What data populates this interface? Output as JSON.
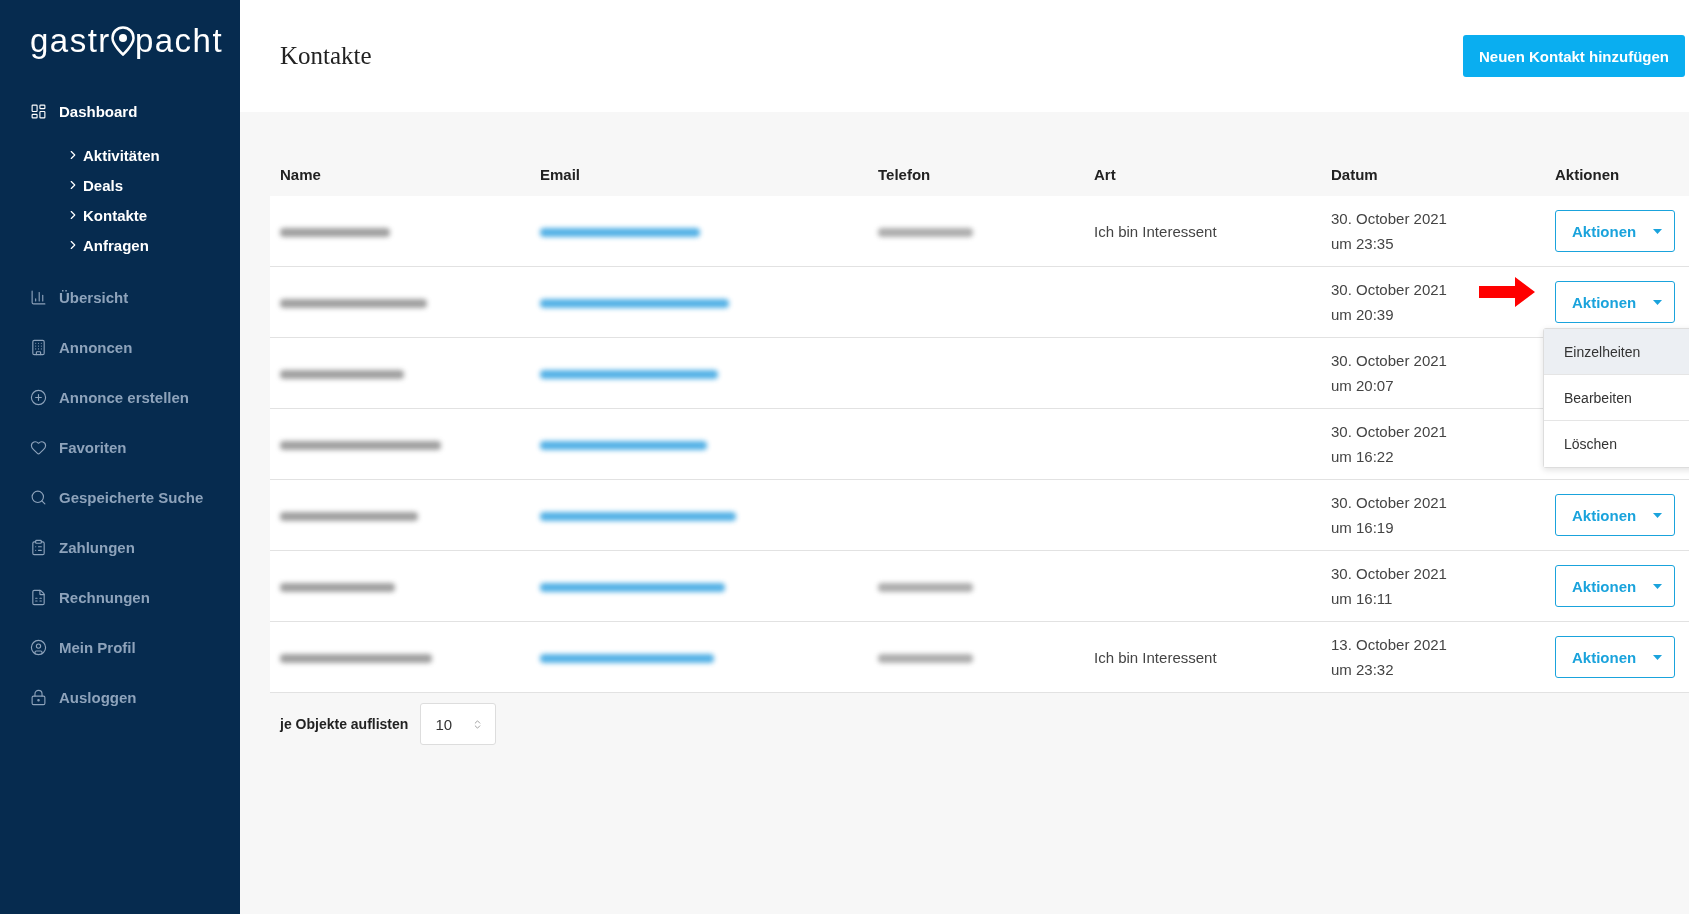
{
  "logo": {
    "left": "gastr",
    "right": "pacht"
  },
  "sidebar": {
    "items": [
      {
        "label": "Dashboard",
        "active": true,
        "expanded": true,
        "children": [
          {
            "label": "Aktivitäten",
            "active": true
          },
          {
            "label": "Deals",
            "active": true
          },
          {
            "label": "Kontakte",
            "active": true
          },
          {
            "label": "Anfragen",
            "active": true
          }
        ]
      },
      {
        "label": "Übersicht",
        "active": false
      },
      {
        "label": "Annoncen",
        "active": false
      },
      {
        "label": "Annonce erstellen",
        "active": false
      },
      {
        "label": "Favoriten",
        "active": false
      },
      {
        "label": "Gespeicherte Suche",
        "active": false
      },
      {
        "label": "Zahlungen",
        "active": false
      },
      {
        "label": "Rechnungen",
        "active": false
      },
      {
        "label": "Mein Profil",
        "active": false
      },
      {
        "label": "Ausloggen",
        "active": false
      }
    ]
  },
  "page": {
    "title": "Kontakte",
    "add_button": "Neuen Kontakt hinzufügen"
  },
  "table": {
    "columns": [
      "Name",
      "Email",
      "Telefon",
      "Art",
      "Datum",
      "Aktionen"
    ],
    "rows": [
      {
        "name": {
          "kind": "blurred"
        },
        "email": {
          "kind": "blurred"
        },
        "phone": {
          "kind": "blurred"
        },
        "art": "Ich bin Interessent",
        "date": "30. October 2021",
        "time": "um 23:35",
        "action": "Aktionen"
      },
      {
        "name": {
          "kind": "blurred"
        },
        "email": {
          "kind": "blurred"
        },
        "date": "30. October 2021",
        "time": "um 20:39",
        "action": "Aktionen",
        "menu": [
          {
            "label": "Einzelheiten",
            "selected": true
          },
          {
            "label": "Bearbeiten",
            "selected": false
          },
          {
            "label": "Löschen",
            "selected": false
          }
        ]
      },
      {
        "name": {
          "kind": "blurred"
        },
        "email": {
          "kind": "blurred"
        },
        "date": "30. October 2021",
        "time": "um 20:07"
      },
      {
        "name": {
          "kind": "blurred"
        },
        "email": {
          "kind": "blurred"
        },
        "date": "30. October 2021",
        "time": "um 16:22"
      },
      {
        "name": {
          "kind": "blurred"
        },
        "email": {
          "kind": "blurred"
        },
        "date": "30. October 2021",
        "time": "um 16:19",
        "action": "Aktionen"
      },
      {
        "name": {
          "kind": "blurred"
        },
        "email": {
          "kind": "blurred"
        },
        "phone": {
          "kind": "blurred"
        },
        "date": "30. October 2021",
        "time": "um 16:11",
        "action": "Aktionen"
      },
      {
        "name": {
          "kind": "blurred"
        },
        "email": {
          "kind": "blurred"
        },
        "phone": {
          "kind": "blurred"
        },
        "art": "Ich bin Interessent",
        "date": "13. October 2021",
        "time": "um 23:32",
        "action": "Aktionen"
      }
    ]
  },
  "pagination": {
    "label": "je Objekte auflisten",
    "value": "10"
  }
}
